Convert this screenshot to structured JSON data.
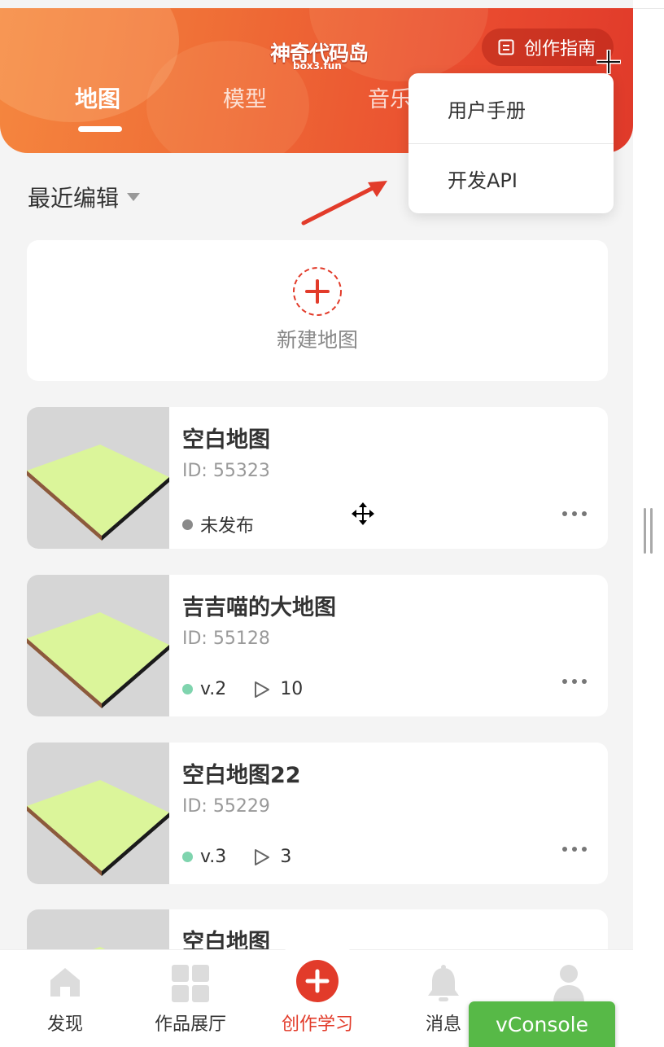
{
  "header": {
    "logo_text": "神奇代码岛",
    "logo_sub": "box3.fun",
    "guide_label": "创作指南",
    "tabs": [
      {
        "label": "地图",
        "active": true
      },
      {
        "label": "模型",
        "active": false
      },
      {
        "label": "音乐",
        "active": false
      }
    ]
  },
  "dropdown_menu": {
    "items": [
      {
        "label": "用户手册"
      },
      {
        "label": "开发API"
      }
    ]
  },
  "sort": {
    "label": "最近编辑"
  },
  "new_map": {
    "label": "新建地图"
  },
  "maps": [
    {
      "title": "空白地图",
      "id": "ID: 55323",
      "status": "未发布",
      "status_color": "#8a8a8a"
    },
    {
      "title": "吉吉喵的大地图",
      "id": "ID: 55128",
      "version": "v.2",
      "plays": "10",
      "status_color": "#7fd4ae"
    },
    {
      "title": "空白地图22",
      "id": "ID: 55229",
      "version": "v.3",
      "plays": "3",
      "status_color": "#7fd4ae"
    },
    {
      "title": "空白地图"
    }
  ],
  "bottom_nav": [
    {
      "label": "发现",
      "icon": "home-icon"
    },
    {
      "label": "作品展厅",
      "icon": "grid-icon"
    },
    {
      "label": "创作学习",
      "icon": "plus-circle-icon",
      "active": true
    },
    {
      "label": "消息",
      "icon": "bell-icon"
    },
    {
      "label": "",
      "icon": "user-icon"
    }
  ],
  "vconsole": {
    "label": "vConsole"
  },
  "colors": {
    "accent": "#e23b2a",
    "published_dot": "#7fd4ae",
    "unpublished_dot": "#8a8a8a",
    "vconsole": "#57b947"
  }
}
